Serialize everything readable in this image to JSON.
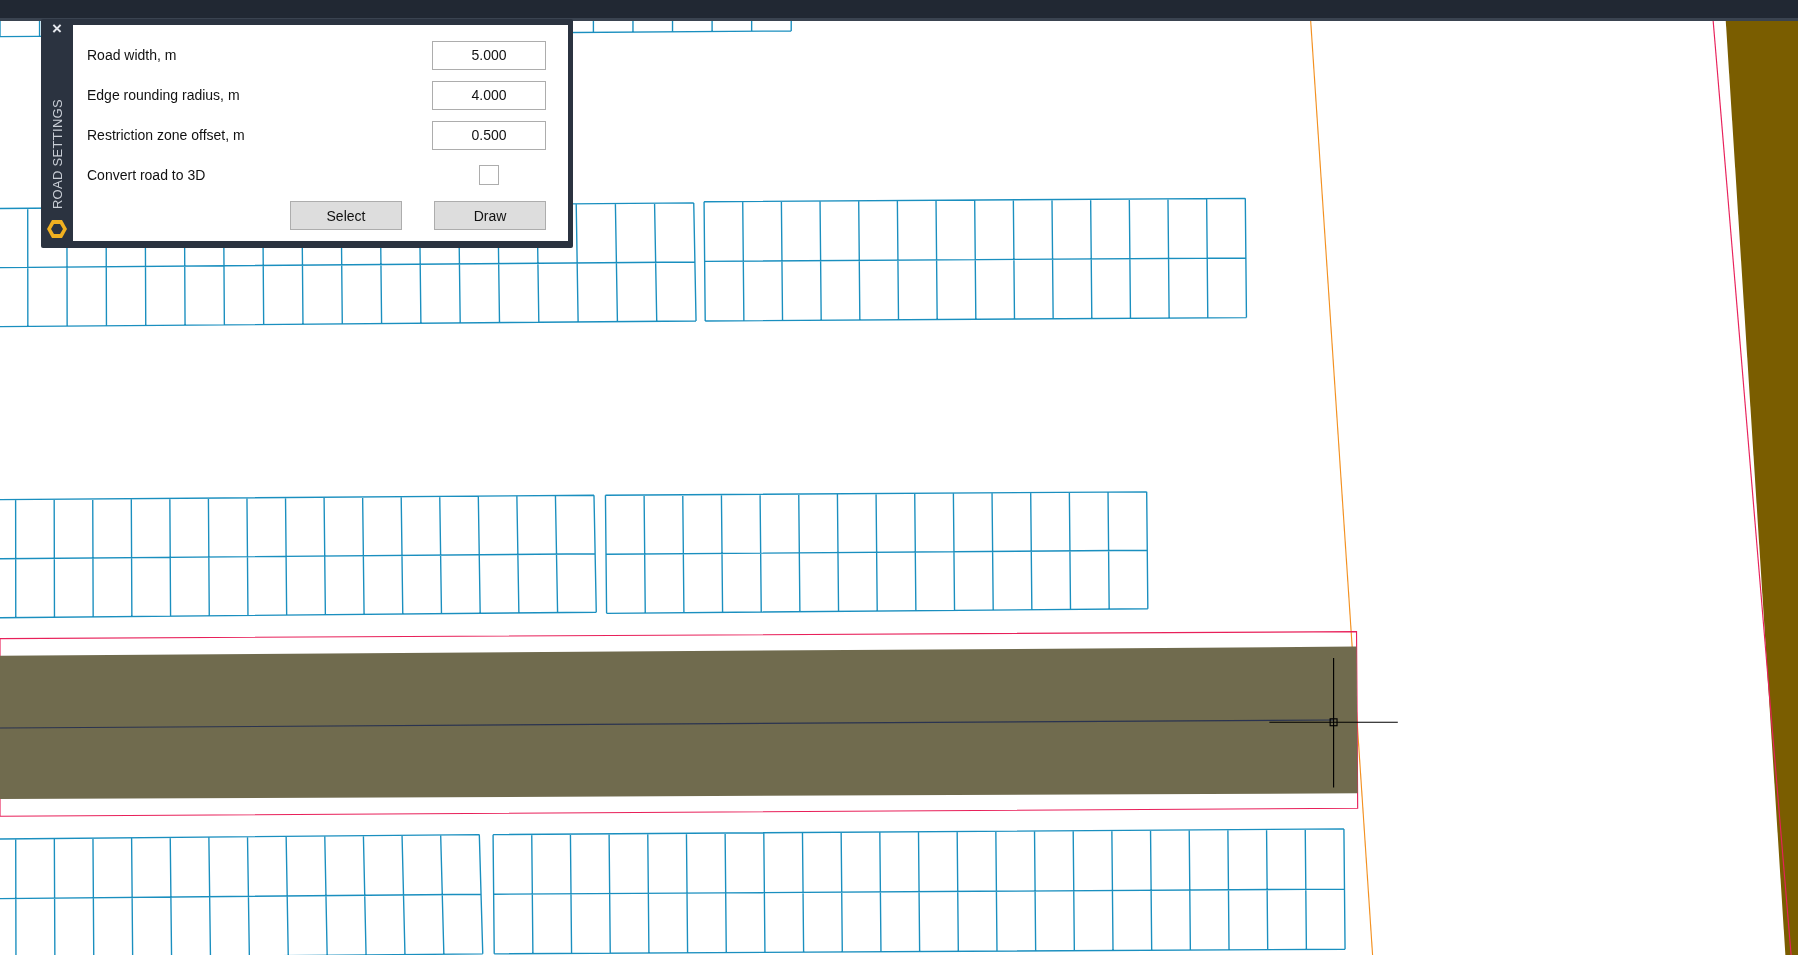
{
  "panel": {
    "title": "ROAD SETTINGS",
    "close": "×",
    "rows": [
      {
        "kind": "input",
        "label": "Road width, m",
        "value": "5.000"
      },
      {
        "kind": "input",
        "label": "Edge rounding radius, m",
        "value": "4.000"
      },
      {
        "kind": "input",
        "label": "Restriction zone offset, m",
        "value": "0.500"
      },
      {
        "kind": "checkbox",
        "label": "Convert road to 3D",
        "checked": false
      }
    ],
    "buttons": [
      "Select",
      "Draw"
    ]
  }
}
